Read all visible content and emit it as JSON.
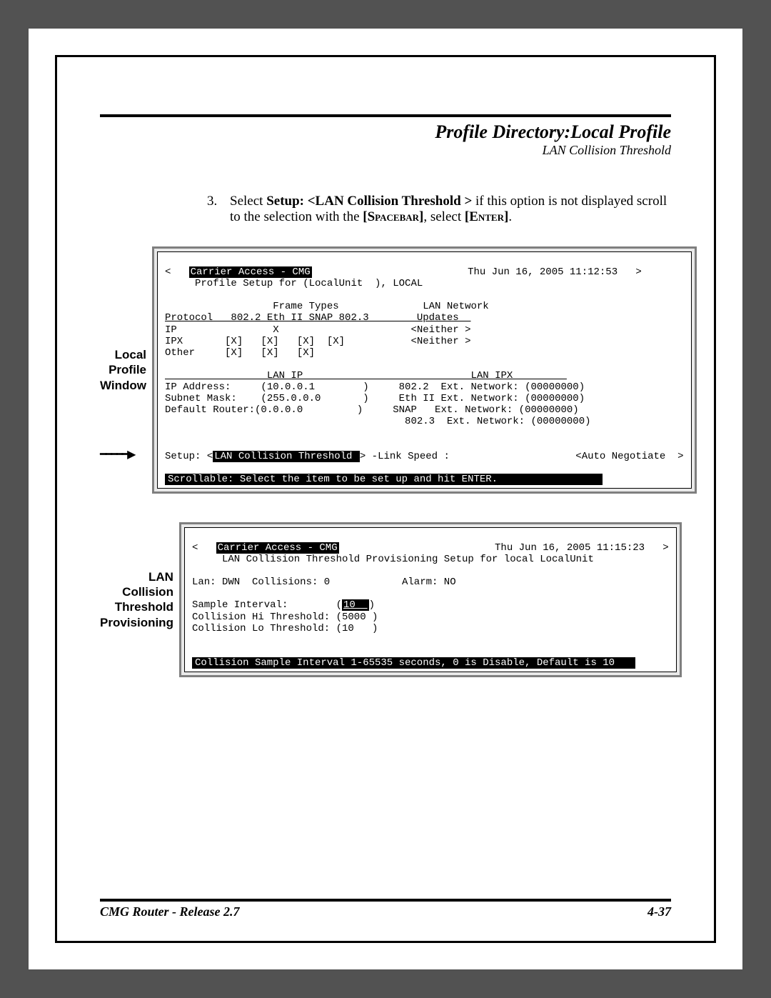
{
  "header": {
    "title": "Profile Directory:Local Profile",
    "subtitle": "LAN Collision Threshold"
  },
  "instruction": {
    "num": "3.",
    "pre": "Select ",
    "bold1": "Setup: <LAN Collision Threshold >",
    "mid": " if this option is not displayed scroll to the selection with the ",
    "key1": "[Spacebar]",
    "sep": ", select ",
    "key2": "[Enter]",
    "end": "."
  },
  "callout1": "Local Profile Window",
  "term1": {
    "title_left": "Carrier Access - CMG",
    "title_right": "Thu Jun 16, 2005 11:12:53",
    "line2": "     Profile Setup for (LocalUnit  ), LOCAL",
    "ft_label": "                  Frame Types              LAN Network",
    "hdr": "Protocol   802.2 Eth II SNAP 802.3        Updates  ",
    "r_ip": "IP                X                      <Neither >",
    "r_ipx": "IPX       [X]   [X]   [X]  [X]           <Neither >",
    "r_oth": "Other     [X]   [X]   [X]",
    "lan_hdr": "                 LAN IP                            LAN IPX         ",
    "lan1": "IP Address:     (10.0.0.1        )     802.2  Ext. Network: (00000000)",
    "lan2": "Subnet Mask:    (255.0.0.0       )     Eth II Ext. Network: (00000000)",
    "lan3": "Default Router:(0.0.0.0         )     SNAP   Ext. Network: (00000000)",
    "lan4": "                                        802.3  Ext. Network: (00000000)",
    "setup_pre": "Setup: <",
    "setup_sel": "LAN Collision Threshold ",
    "setup_post": "> -Link Speed :                     <Auto Negotiate  >",
    "status": "Scrollable: Select the item to be set up and hit ENTER.                 "
  },
  "callout2": "LAN Collision Threshold Provisioning",
  "term2": {
    "title_left": "Carrier Access - CMG",
    "title_right": "Thu Jun 16, 2005 11:15:23",
    "line2": "     LAN Collision Threshold Provisioning Setup for local LocalUnit",
    "stat": "Lan: DWN  Collisions: 0            Alarm: NO",
    "f1_l": "Sample Interval:        (",
    "f1_v": "10  ",
    "f1_r": ")",
    "f2": "Collision Hi Threshold: (5000 )",
    "f3": "Collision Lo Threshold: (10   )",
    "status": "Collision Sample Interval 1-65535 seconds, 0 is Disable, Default is 10   "
  },
  "footer": {
    "left": "CMG Router - Release 2.7",
    "right": "4-37"
  }
}
